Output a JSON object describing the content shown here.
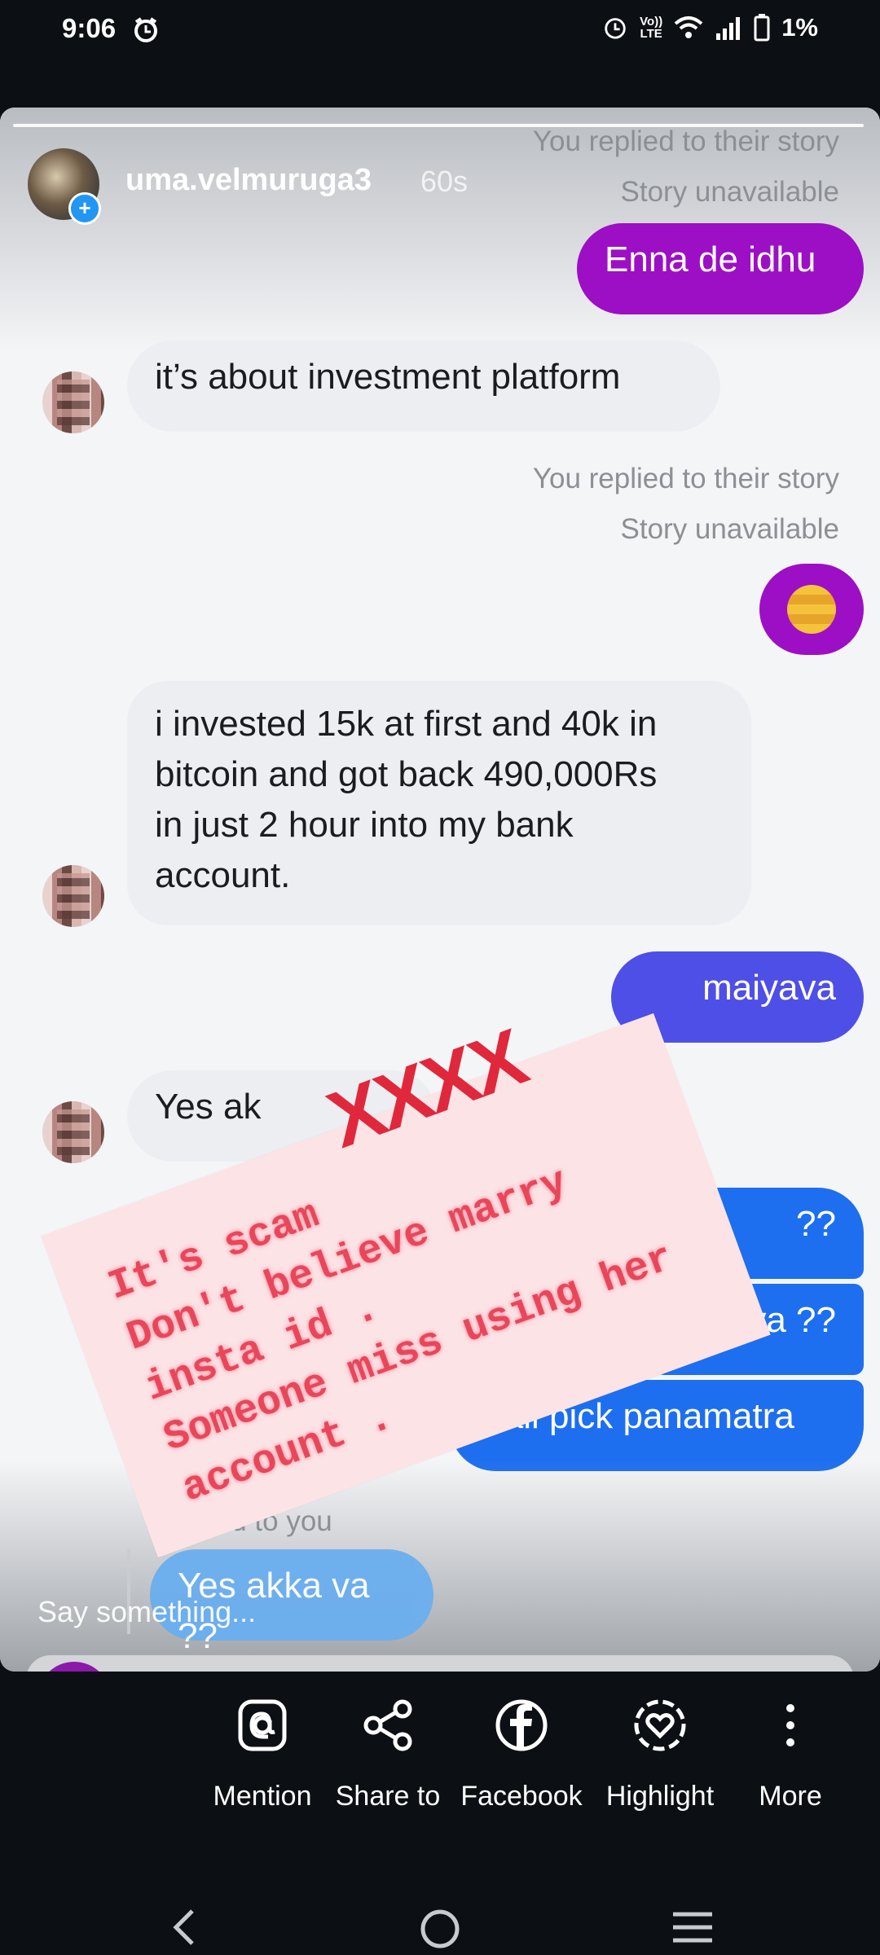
{
  "status_bar": {
    "time": "9:06",
    "battery": "1%",
    "volte_top": "Vo))",
    "volte_bottom": "LTE"
  },
  "story": {
    "username": "uma.velmuruga3",
    "time_ago": "60s",
    "say_placeholder": "Say something..."
  },
  "conversation": {
    "reply_meta_1": "You replied to their story",
    "story_unavailable_1": "Story unavailable",
    "msg_out_1": "Enna de idhu",
    "msg_in_1": "it’s about investment platform",
    "reply_meta_2": "You replied to their story",
    "story_unavailable_2": "Story unavailable",
    "msg_in_2_lines": [
      "i invested 15k at first and 40k in",
      "bitcoin and got back 490,000Rs",
      "in just 2 hour into my bank",
      "account."
    ],
    "msg_out_2": "maiyava",
    "msg_in_3": "Yes ak",
    "msg_out_3": "??",
    "msg_out_4": "nya ??",
    "msg_out_5": "Call pick panamatra",
    "replied_to_you": "Replied to you",
    "msg_quoted": "Yes akka va ??"
  },
  "overlay": {
    "marks": "XXXX",
    "lines": [
      "It's scam",
      "Don't believe marry",
      "insta id .",
      "Someone miss using her",
      "account ."
    ]
  },
  "share_tray": [
    {
      "label": "Mention",
      "icon": "at-icon"
    },
    {
      "label": "Share to",
      "icon": "share-icon"
    },
    {
      "label": "Facebook",
      "icon": "facebook-icon"
    },
    {
      "label": "Highlight",
      "icon": "highlight-heart-icon"
    },
    {
      "label": "More",
      "icon": "more-vertical-icon"
    }
  ],
  "colors": {
    "out_purple": "#9d0fc4",
    "out_violet": "#4e4fe6",
    "out_blue": "#1e6ff0",
    "out_light_blue": "#6aaeef",
    "scam_text": "#e8475b"
  }
}
